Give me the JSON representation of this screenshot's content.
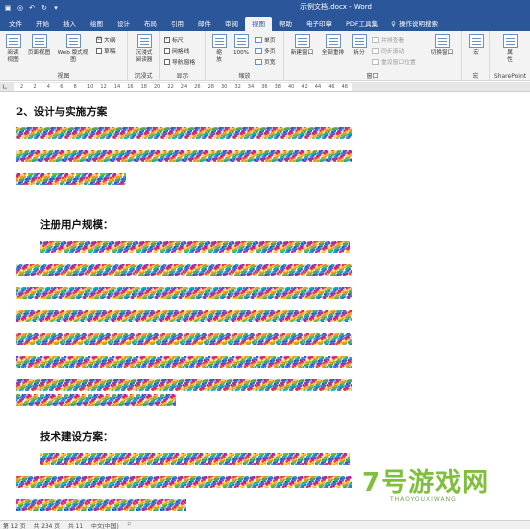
{
  "titlebar": {
    "title": "示例文档.docx  -  Word",
    "bg_color": "#2b579a"
  },
  "tabs": [
    {
      "label": "文件"
    },
    {
      "label": "开始"
    },
    {
      "label": "插入"
    },
    {
      "label": "绘图"
    },
    {
      "label": "设计"
    },
    {
      "label": "布局"
    },
    {
      "label": "引用"
    },
    {
      "label": "邮件"
    },
    {
      "label": "审阅"
    },
    {
      "label": "视图"
    },
    {
      "label": "帮助"
    },
    {
      "label": "电子印章"
    },
    {
      "label": "PDF工具集"
    }
  ],
  "tab_search": "操作说明搜索",
  "ribbon": {
    "views": {
      "read_mode": "阅读\n视图",
      "print_layout": "页面视图",
      "web_layout": "Web 版式视图",
      "outline": "大纲",
      "draft": "草稿",
      "label": "视图"
    },
    "immersive": {
      "reader": "沉浸式\n阅读器",
      "label": "沉浸式"
    },
    "show": {
      "ruler": "标尺",
      "gridlines": "网格线",
      "nav_pane": "导航窗格",
      "label": "显示"
    },
    "zoom": {
      "zoom": "缩\n放",
      "percent": "100%",
      "one_page": "单页",
      "multi_page": "多页",
      "page_width": "页宽",
      "label": "缩放"
    },
    "window": {
      "new_window": "新建窗口",
      "arrange_all": "全部重排",
      "split": "拆分",
      "side_by_side": "并排查看",
      "sync_scroll": "同步滚动",
      "reset_position": "重设窗口位置",
      "switch_windows": "切换窗口",
      "label": "窗口"
    },
    "macros": {
      "macros": "宏",
      "label": "宏"
    },
    "sharepoint": {
      "properties": "属\n性",
      "label": "SharePoint"
    }
  },
  "ruler": {
    "numbers": [
      "2",
      "2",
      "4",
      "6",
      "8",
      "10",
      "12",
      "14",
      "16",
      "18",
      "20",
      "22",
      "24",
      "26",
      "28",
      "30",
      "32",
      "34",
      "36",
      "38",
      "40",
      "42",
      "44",
      "46",
      "48"
    ]
  },
  "document": {
    "heading1": "2、设计与实施方案",
    "heading2": "注册用户规模：",
    "heading3": "技术建设方案："
  },
  "statusbar": {
    "page": "第 12 页",
    "words": "共 234 页",
    "wordcount": "共 11",
    "language": "中文(中国)"
  },
  "watermark": {
    "logo": "7号游戏网",
    "sub": "THAOYOUXIWANG"
  }
}
